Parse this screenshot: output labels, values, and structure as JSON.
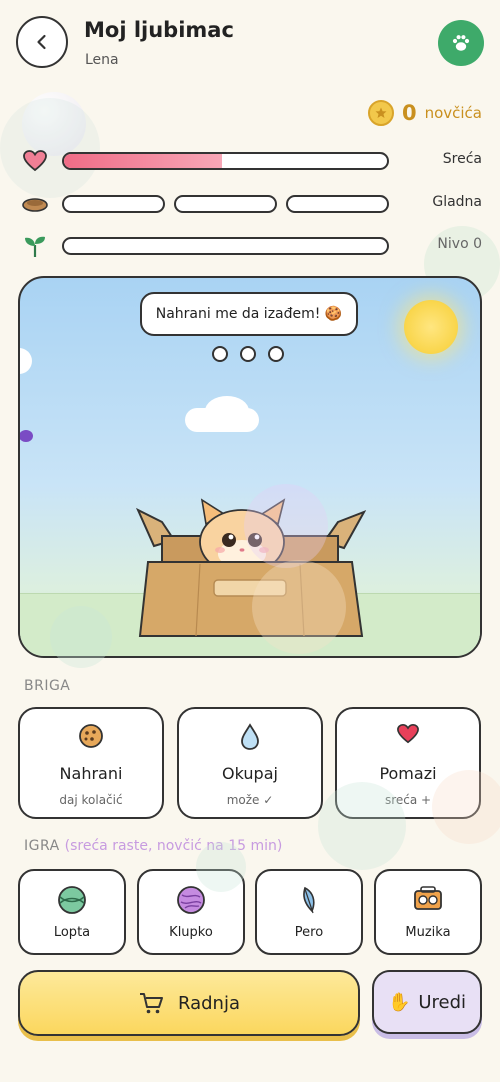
{
  "header": {
    "title": "Moj ljubimac",
    "subtitle": "Lena"
  },
  "coins": {
    "count": "0",
    "label": "novčića"
  },
  "stats": {
    "happiness": {
      "label": "Sreća",
      "level": 0.49
    },
    "hunger": {
      "label": "Gladna",
      "segments_filled": 0,
      "segments_total": 3
    },
    "growth": {
      "label": "Nivo 0",
      "level": 0
    }
  },
  "scene": {
    "speech": "Nahrani me da izađem! 🍪",
    "pending_dots": 3
  },
  "care": {
    "section_label": "BRIGA",
    "cards": [
      {
        "title": "Nahrani",
        "sub": "daj kolačić",
        "icon": "cookie-icon"
      },
      {
        "title": "Okupaj",
        "sub": "može ✓",
        "icon": "water-drop-icon"
      },
      {
        "title": "Pomazi",
        "sub": "sreća +",
        "icon": "heart-icon"
      }
    ]
  },
  "play": {
    "section_label": "IGRA",
    "section_hint": "(sreća raste, novčić na 15 min)",
    "cards": [
      {
        "title": "Lopta",
        "icon": "ball-icon"
      },
      {
        "title": "Klupko",
        "icon": "yarn-icon"
      },
      {
        "title": "Pero",
        "icon": "feather-icon"
      },
      {
        "title": "Muzika",
        "icon": "radio-icon"
      }
    ]
  },
  "actions": {
    "shop_label": "Radnja",
    "edit_label": "Uredi",
    "edit_emoji": "✋"
  },
  "colors": {
    "accent_green": "#3eaa6a",
    "coin_gold": "#c9901f",
    "happiness_pink": "#ef6c86",
    "shop_yellow": "#fbd75e",
    "edit_lavender": "#e8e0f5"
  }
}
